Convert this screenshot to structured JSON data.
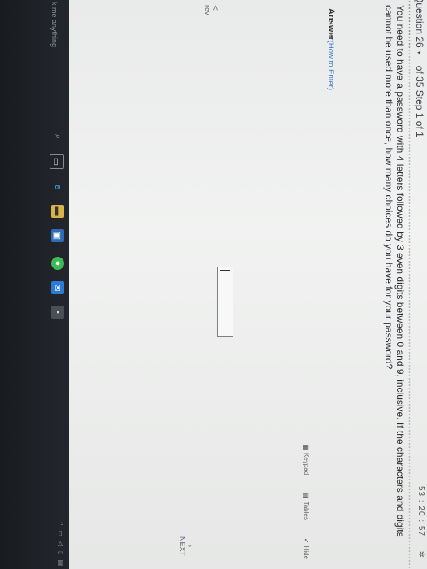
{
  "header": {
    "question_label": "Question 26",
    "of_text": "of 35 Step 1 of 1",
    "timer": "53 : 20 : 57"
  },
  "question": {
    "text": "You need to have a password with 4 letters followed by 3 even digits between 0 and 9, inclusive. If the characters and digits cannot be used more than once, how many choices do you have for your password?"
  },
  "answer": {
    "label": "Answer",
    "help": "(How to Enter)",
    "value": ""
  },
  "tools": {
    "keypad": "Keypad",
    "tables": "Tables",
    "hide": "Hide"
  },
  "nav": {
    "prev_arrow": "<",
    "prev_label": "rev",
    "next_label": "NEXT"
  },
  "taskbar": {
    "search_text": "k me anything"
  },
  "icons": {
    "dropdown": "chevron-down-icon",
    "gear": "gear-icon"
  },
  "colors": {
    "link": "#3a7fc8",
    "taskbar": "#1a1d22"
  }
}
